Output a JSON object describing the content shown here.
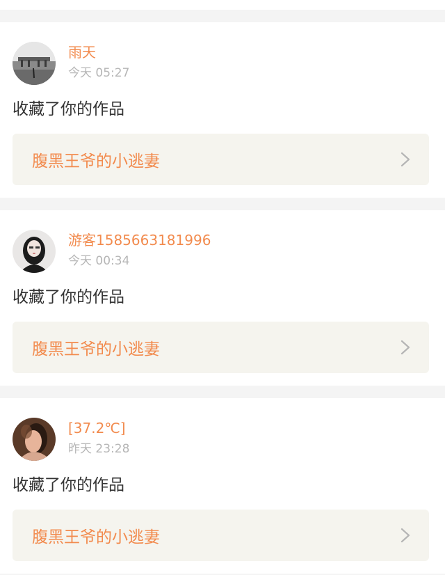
{
  "notifications": [
    {
      "username": "雨天",
      "time": "今天 05:27",
      "action": "收藏了你的作品",
      "work_title": "腹黑王爷的小逃妻",
      "avatar_icon": "rain-landscape-avatar-icon"
    },
    {
      "username": "游客1585663181996",
      "time": "今天 00:34",
      "action": "收藏了你的作品",
      "work_title": "腹黑王爷的小逃妻",
      "avatar_icon": "girl-portrait-avatar-icon"
    },
    {
      "username": "[37.2℃]",
      "time": "昨天 23:28",
      "action": "收藏了你的作品",
      "work_title": "腹黑王爷的小逃妻",
      "avatar_icon": "warm-portrait-avatar-icon"
    }
  ],
  "colors": {
    "accent": "#f28b4e",
    "time_text": "#b6b6b6",
    "link_bg": "#f5f4ee",
    "page_bg": "#f4f4f4"
  }
}
